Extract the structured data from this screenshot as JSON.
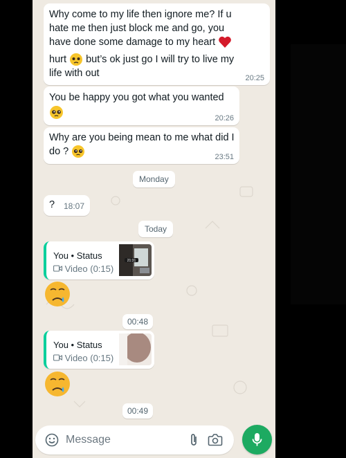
{
  "messages": [
    {
      "text": "Why come to my life then ignore me? If u hate me then just block me and go, you have done some damage to my heart",
      "text_after": "hurt",
      "text_after2": "but’s ok just go I will try to live my life with out",
      "time": "20:25"
    },
    {
      "text": "You be happy you got what you wanted",
      "time": "20:26"
    },
    {
      "text": "Why are you being mean to me what did I do ?",
      "time": "23:51"
    }
  ],
  "date_monday": "Monday",
  "question": {
    "text": "?",
    "time": "18:07"
  },
  "date_today": "Today",
  "status_replies": [
    {
      "name": "You • Status",
      "sub": "Video (0:15)",
      "thumb_time": "21:31",
      "time": "00:48"
    },
    {
      "name": "You • Status",
      "sub": "Video (0:15)",
      "time": "00:49"
    }
  ],
  "composer": {
    "placeholder": "Message"
  },
  "icons": [
    "emoji-icon",
    "attach-icon",
    "camera-icon",
    "mic-icon",
    "red-heart-icon",
    "pleading-face-icon",
    "sad-tear-face-icon"
  ],
  "colors": {
    "accent": "#1daa61",
    "status_bar": "#06cf9c",
    "wallpaper": "#efeae2"
  }
}
